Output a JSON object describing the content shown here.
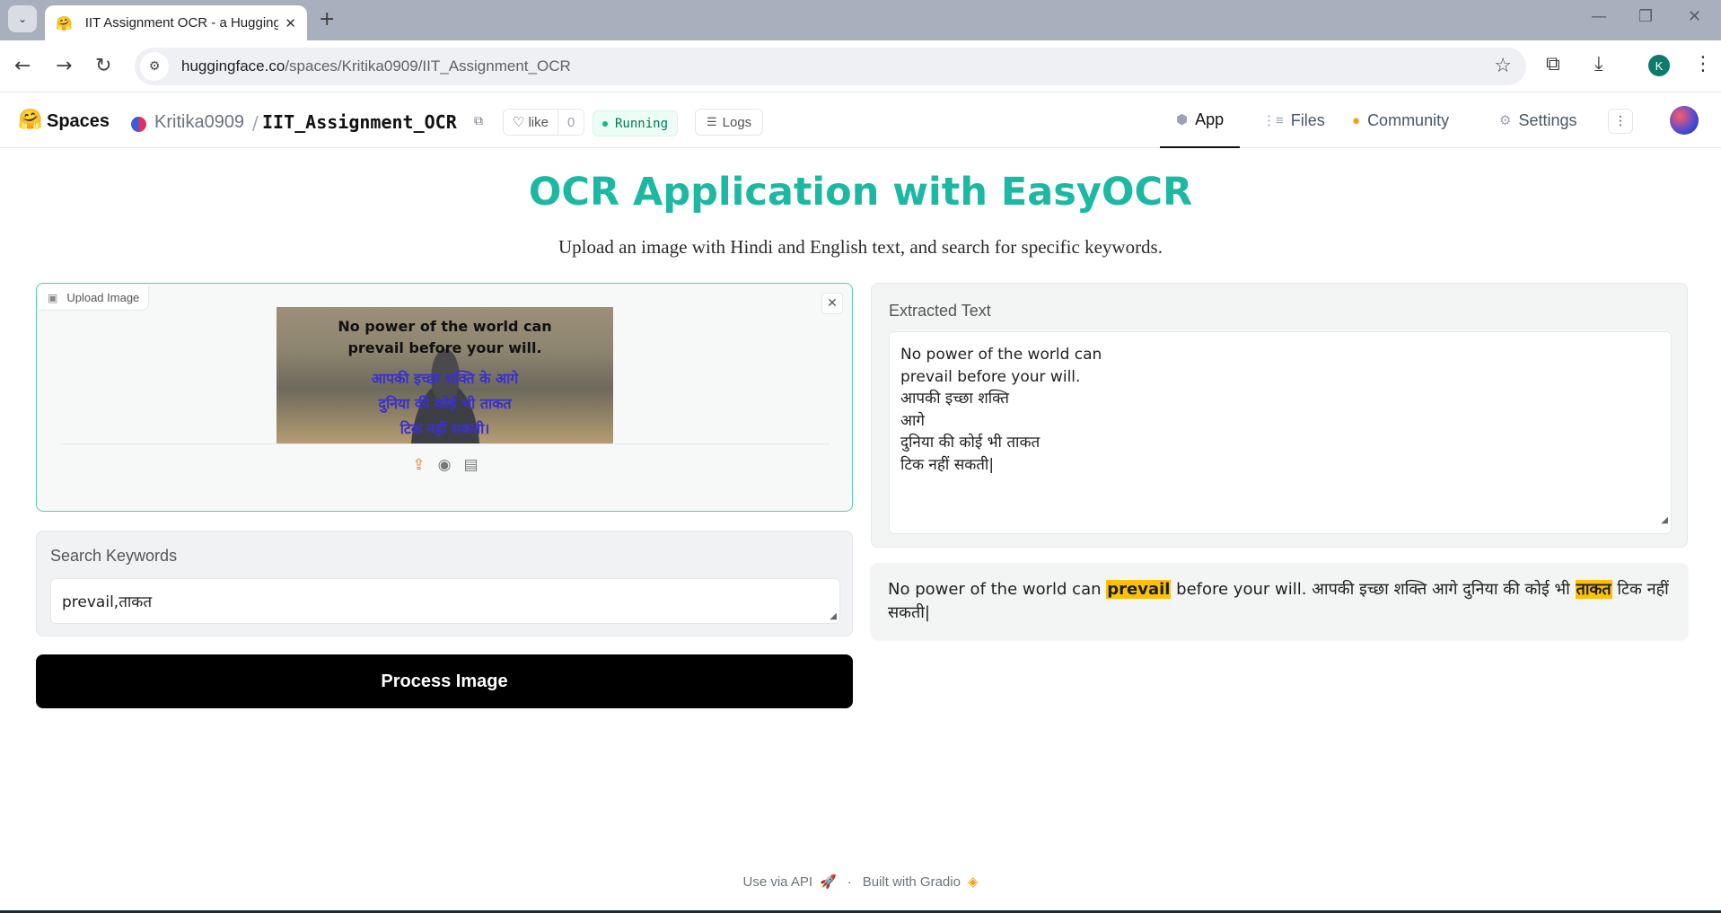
{
  "browser": {
    "tab_title": "IIT Assignment OCR - a Hugging Face Space",
    "tab_favicon": "🤗",
    "url_host": "huggingface.co",
    "url_path": "/spaces/Kritika0909/IIT_Assignment_OCR",
    "profile_initial": "K"
  },
  "hf_header": {
    "brand": "Spaces",
    "owner": "Kritika0909",
    "separator": "/",
    "repo": "IIT_Assignment_OCR",
    "like_label": "like",
    "like_count": "0",
    "status": "Running",
    "logs_label": "Logs",
    "tabs": [
      {
        "label": "App",
        "icon": "cube-icon",
        "active": true
      },
      {
        "label": "Files",
        "icon": "files-icon",
        "active": false
      },
      {
        "label": "Community",
        "icon": "community-icon",
        "active": false
      },
      {
        "label": "Settings",
        "icon": "gear-icon",
        "active": false
      }
    ]
  },
  "app": {
    "title": "OCR Application with EasyOCR",
    "subtitle": "Upload an image with Hindi and English text, and search for specific keywords.",
    "upload_label": "Upload Image",
    "preview_lines": {
      "en1": "No power of the world can",
      "en2": "prevail before your will.",
      "hi1": "आपकी इच्छा शक्ति के आगे",
      "hi2": "दुनिया की कोई भी ताकत",
      "hi3": "टिक नहीं सकती।"
    },
    "search_label": "Search Keywords",
    "search_value": "prevail,ताकत",
    "process_button": "Process Image",
    "extracted_label": "Extracted Text",
    "extracted_lines": [
      "No power of the world can",
      "prevail before your will.",
      "आपकी इच्छा शक्ति",
      "आगे",
      "दुनिया की कोई भी ताकत",
      "टिक नहीं सकती|"
    ],
    "highlighted": {
      "before1": "No power of the world can ",
      "kw1": "prevail",
      "between": " before your will. आपकी इच्छा शक्ति आगे दुनिया की कोई भी ",
      "kw2": "ताकत",
      "after": " टिक नहीं सकती|"
    },
    "highlight_color": "#ffc107",
    "accent_color": "#1cb8a2"
  },
  "footer": {
    "api_label": "Use via API",
    "separator": "·",
    "built_label": "Built with Gradio"
  }
}
